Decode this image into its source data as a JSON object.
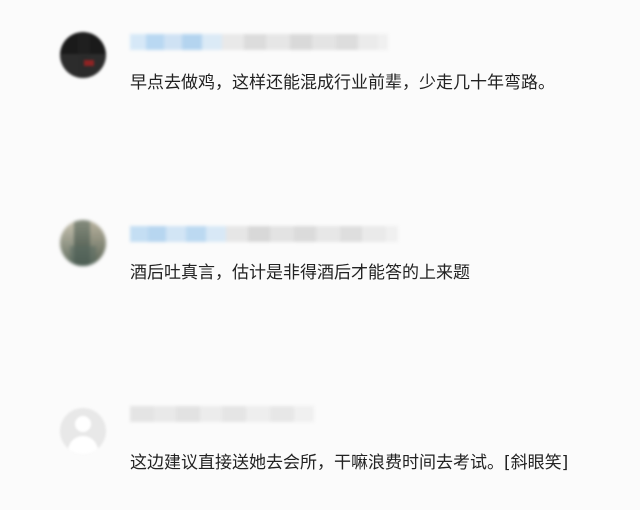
{
  "comments": [
    {
      "text": "早点去做鸡，这样还能混成行业前辈，少走几十年弯路。"
    },
    {
      "text": "酒后吐真言，估计是非得酒后才能答的上来题"
    },
    {
      "text": "这边建议直接送她去会所，干嘛浪费时间去考试。[斜眼笑]"
    }
  ],
  "colors": {
    "background": "#fbfbfb",
    "text": "#222222",
    "name_blur_blue": "#c6dff3",
    "name_blur_gray": "#e2e2e2"
  }
}
